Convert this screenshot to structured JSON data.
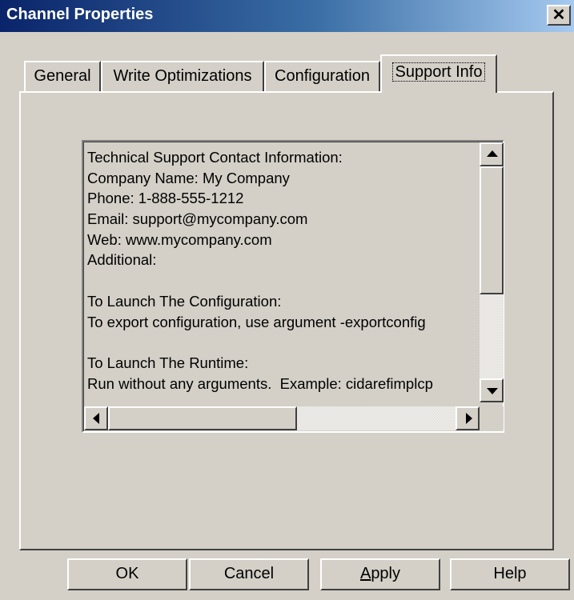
{
  "window": {
    "title": "Channel Properties",
    "close_glyph": "✕",
    "close_icon": "close-icon"
  },
  "tabs": [
    {
      "label": "General",
      "selected": false
    },
    {
      "label": "Write Optimizations",
      "selected": false
    },
    {
      "label": "Configuration",
      "selected": false
    },
    {
      "label": "Support Info",
      "selected": true
    }
  ],
  "support_info": {
    "lines": [
      "Technical Support Contact Information:",
      "Company Name: My Company",
      "Phone: 1-888-555-1212",
      "Email: support@mycompany.com",
      "Web: www.mycompany.com",
      "Additional:",
      "",
      "To Launch The Configuration:",
      "To export configuration, use argument -exportconfig",
      "",
      "To Launch The Runtime:",
      "Run without any arguments.  Example: cidarefimplcp"
    ],
    "scrollbars": {
      "vertical": {
        "up_icon": "arrow-up-icon",
        "down_icon": "arrow-down-icon"
      },
      "horizontal": {
        "left_icon": "arrow-left-icon",
        "right_icon": "arrow-right-icon"
      }
    }
  },
  "buttons": {
    "ok": "OK",
    "cancel": "Cancel",
    "apply_first": "A",
    "apply_rest": "pply",
    "help": "Help"
  },
  "colors": {
    "face": "#d4d0c8",
    "title_start": "#0a246a",
    "title_end": "#a6caf0"
  }
}
